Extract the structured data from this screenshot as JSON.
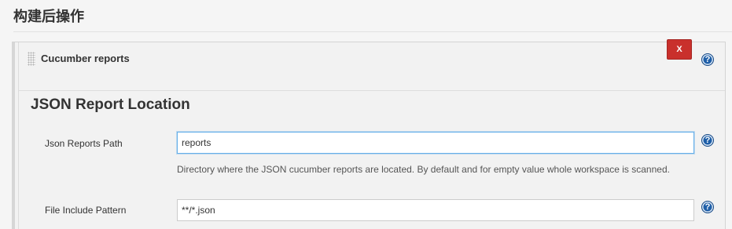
{
  "section": {
    "title": "构建后操作"
  },
  "step": {
    "name": "Cucumber reports",
    "delete_label": "X",
    "help_symbol": "?"
  },
  "json_report": {
    "title": "JSON Report Location",
    "fields": [
      {
        "label": "Json Reports Path",
        "value": "reports",
        "description": "Directory where the JSON cucumber reports are located. By default and for empty value whole workspace is scanned."
      },
      {
        "label": "File Include Pattern",
        "value": "**/*.json"
      }
    ]
  },
  "colors": {
    "delete_button": "#c9302c",
    "help_icon": "#1f5fa8",
    "focus_border": "#66afe9"
  },
  "icons": [
    "drag-handle-icon",
    "help-icon",
    "delete-icon"
  ]
}
